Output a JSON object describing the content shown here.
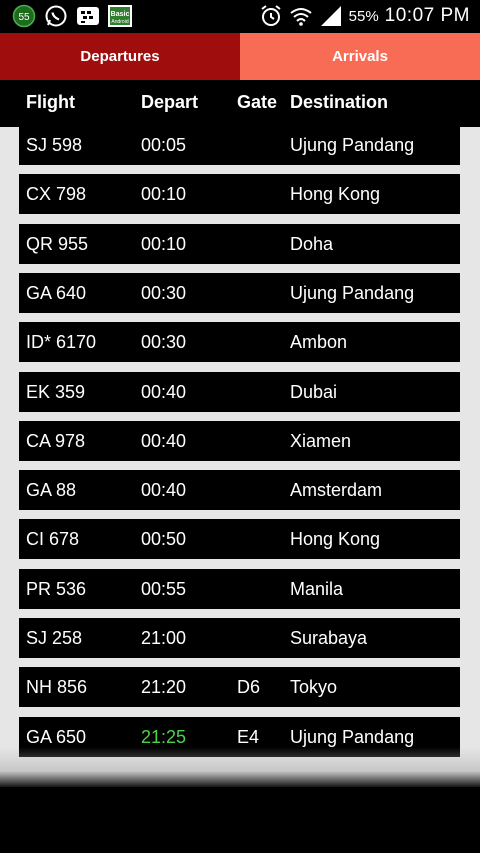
{
  "status_bar": {
    "notif_count": "55",
    "battery": "55%",
    "time": "10:07 PM",
    "bbm_label": "Basic Android",
    "icons": [
      "notification-count-icon",
      "whatsapp-icon",
      "bbm-icon",
      "basic-android-icon",
      "alarm-icon",
      "wifi-icon",
      "signal-icon"
    ]
  },
  "tabs": {
    "departures": "Departures",
    "arrivals": "Arrivals"
  },
  "headers": {
    "flight": "Flight",
    "depart": "Depart",
    "gate": "Gate",
    "destination": "Destination"
  },
  "colors": {
    "departures_tab": "#9f0d0d",
    "arrivals_tab": "#f86b55",
    "highlight_time": "#4cd34c"
  },
  "flights": [
    {
      "flight": "SJ 598",
      "depart": "00:05",
      "gate": "",
      "destination": "Ujung Pandang"
    },
    {
      "flight": "CX 798",
      "depart": "00:10",
      "gate": "",
      "destination": "Hong Kong"
    },
    {
      "flight": "QR 955",
      "depart": "00:10",
      "gate": "",
      "destination": "Doha"
    },
    {
      "flight": "GA 640",
      "depart": "00:30",
      "gate": "",
      "destination": "Ujung Pandang"
    },
    {
      "flight": "ID* 6170",
      "depart": "00:30",
      "gate": "",
      "destination": "Ambon"
    },
    {
      "flight": "EK 359",
      "depart": "00:40",
      "gate": "",
      "destination": "Dubai"
    },
    {
      "flight": "CA 978",
      "depart": "00:40",
      "gate": "",
      "destination": "Xiamen"
    },
    {
      "flight": "GA 88",
      "depart": "00:40",
      "gate": "",
      "destination": "Amsterdam"
    },
    {
      "flight": "CI 678",
      "depart": "00:50",
      "gate": "",
      "destination": "Hong Kong"
    },
    {
      "flight": "PR 536",
      "depart": "00:55",
      "gate": "",
      "destination": "Manila"
    },
    {
      "flight": "SJ 258",
      "depart": "21:00",
      "gate": "",
      "destination": "Surabaya"
    },
    {
      "flight": "NH 856",
      "depart": "21:20",
      "gate": "D6",
      "destination": "Tokyo"
    },
    {
      "flight": "GA 650",
      "depart": "21:25",
      "gate": "E4",
      "destination": "Ujung Pandang",
      "highlight": true
    }
  ]
}
